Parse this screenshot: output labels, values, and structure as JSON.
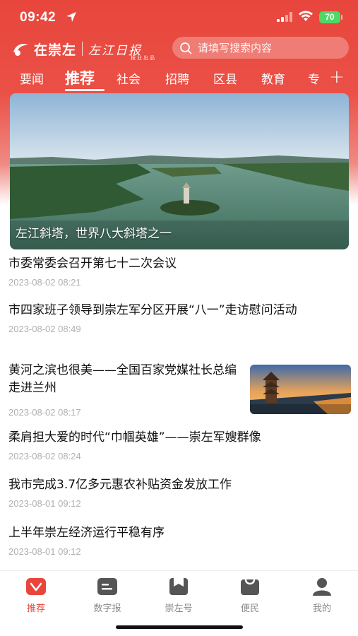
{
  "status": {
    "time": "09:42",
    "battery": "70"
  },
  "header": {
    "logo_text": "在崇左",
    "logo_script": "左江日报",
    "logo_sub": "报业出品",
    "search_placeholder": "请填写搜索内容"
  },
  "tabs": [
    {
      "label": "要闻"
    },
    {
      "label": "推荐",
      "active": true
    },
    {
      "label": "社会"
    },
    {
      "label": "招聘"
    },
    {
      "label": "区县"
    },
    {
      "label": "教育"
    }
  ],
  "tab_more_label": "专",
  "hero": {
    "caption": "左江斜塔，世界八大斜塔之一"
  },
  "news": [
    {
      "title": "市委常委会召开第七十二次会议",
      "date": "2023-08-02 08:21"
    },
    {
      "title": "市四家班子领导到崇左军分区开展“八一”走访慰问活动",
      "date": "2023-08-02 08:49"
    },
    {
      "title": "黄河之滨也很美——全国百家党媒社长总编走进兰州",
      "date": "2023-08-02 08:17"
    },
    {
      "title": "柔肩担大爱的时代“巾帼英雄”——崇左军嫂群像",
      "date": "2023-08-02 08:24"
    },
    {
      "title": "我市完成3.7亿多元惠农补贴资金发放工作",
      "date": "2023-08-01 09:12"
    },
    {
      "title": "上半年崇左经济运行平稳有序",
      "date": "2023-08-01 09:12"
    }
  ],
  "bottom_nav": [
    {
      "label": "推荐",
      "icon": "recommend-heart-icon",
      "active": true
    },
    {
      "label": "数字报",
      "icon": "digital-paper-icon"
    },
    {
      "label": "崇左号",
      "icon": "bookmark-icon"
    },
    {
      "label": "便民",
      "icon": "shopping-bag-icon"
    },
    {
      "label": "我的",
      "icon": "user-profile-icon"
    }
  ],
  "colors": {
    "brand": "#e8463c",
    "inactive": "#888888",
    "date": "#b0b0b0"
  }
}
